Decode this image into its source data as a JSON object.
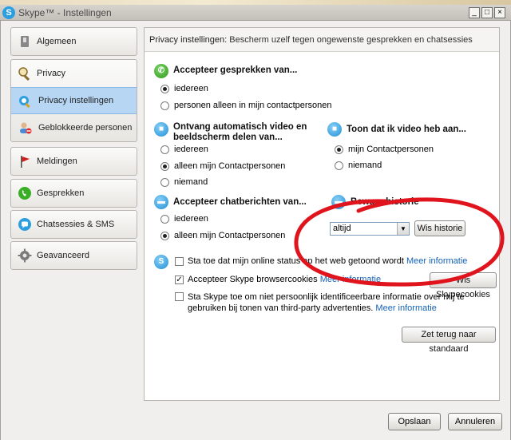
{
  "window": {
    "title": "Skype™ - Instellingen",
    "app_icon": "S",
    "buttons": [
      "_",
      "□",
      "×"
    ]
  },
  "sidebar": {
    "items": [
      {
        "label": "Algemeen",
        "icon": "switch-icon"
      },
      {
        "label": "Privacy",
        "icon": "magnifier-icon"
      },
      {
        "label": "Privacy instellingen",
        "icon": "privacy-settings-icon",
        "active": true
      },
      {
        "label": "Geblokkeerde personen",
        "icon": "blocked-person-icon"
      },
      {
        "label": "Meldingen",
        "icon": "flag-icon"
      },
      {
        "label": "Gesprekken",
        "icon": "phone-icon"
      },
      {
        "label": "Chatsessies & SMS",
        "icon": "chat-icon"
      },
      {
        "label": "Geavanceerd",
        "icon": "gear-icon"
      }
    ]
  },
  "content": {
    "header_title": "Privacy instellingen:",
    "header_sub": "Bescherm uzelf tegen ongewenste gesprekken en chatsessies",
    "calls": {
      "title": "Accepteer gesprekken van...",
      "options": [
        "iedereen",
        "personen alleen in mijn contactpersonen"
      ],
      "selected": 0
    },
    "video": {
      "title": "Ontvang automatisch video en beeldscherm delen van...",
      "options": [
        "iedereen",
        "alleen mijn Contactpersonen",
        "niemand"
      ],
      "selected": 1
    },
    "show_video": {
      "title": "Toon dat ik video heb aan...",
      "options": [
        "mijn Contactpersonen",
        "niemand"
      ],
      "selected": 0
    },
    "chat": {
      "title": "Accepteer chatberichten van...",
      "options": [
        "iedereen",
        "alleen mijn Contactpersonen"
      ],
      "selected": 1
    },
    "history": {
      "title": "Bewaar historie",
      "select_value": "altijd",
      "clear_button": "Wis historie"
    },
    "checks": {
      "online_status": "Sta toe dat mijn online status op het web getoond wordt",
      "online_status_checked": false,
      "online_more": "Meer informatie",
      "cookies": "Accepteer Skype browsercookies",
      "cookies_checked": true,
      "cookies_more": "Meer informatie",
      "cookies_button": "Wis Skypecookies",
      "thirdparty": "Sta Skype toe om niet persoonlijk identificeerbare informatie over mij te gebruiken bij tonen van third-party advertenties.",
      "thirdparty_checked": false,
      "thirdparty_more": "Meer informatie"
    },
    "reset_button": "Zet terug naar standaard"
  },
  "footer": {
    "save": "Opslaan",
    "cancel": "Annuleren"
  },
  "colors": {
    "active_nav": "#b6d6f4",
    "link": "#1462b6",
    "annotation": "#e0141c"
  }
}
